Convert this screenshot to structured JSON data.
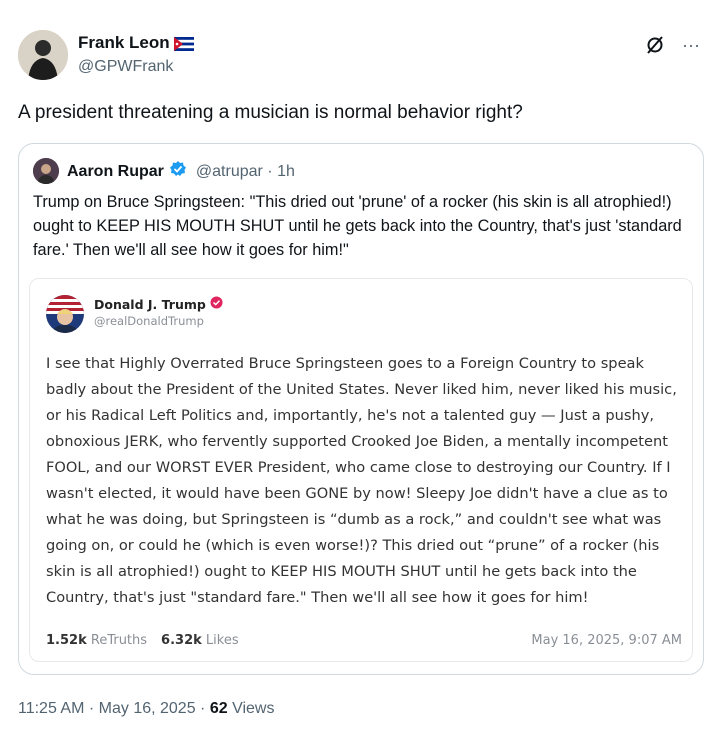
{
  "post": {
    "author_name": "Frank Leon",
    "author_handle": "@GPWFrank",
    "text": "A president threatening a musician is normal behavior right?",
    "time": "11:25 AM",
    "date": "May 16, 2025",
    "views_count": "62",
    "views_label": "Views",
    "more_glyph": "···"
  },
  "quote": {
    "author_name": "Aaron Rupar",
    "author_handle": "@atrupar",
    "age": "1h",
    "text": "Trump on Bruce Springsteen: \"This dried out 'prune' of a rocker (his skin is all atrophied!) ought to KEEP HIS MOUTH SHUT until he gets back into the Country, that's just 'standard fare.' Then we'll all see how it goes for him!\""
  },
  "truth": {
    "author_name": "Donald J. Trump",
    "author_handle": "@realDonaldTrump",
    "text": "I see that Highly Overrated Bruce Springsteen goes to a Foreign Country to speak badly about the President of the United States. Never liked him, never liked his music, or his Radical Left Politics and, importantly, he's not a talented guy — Just a pushy, obnoxious JERK, who fervently supported Crooked Joe Biden, a mentally incompetent FOOL, and our WORST EVER President, who came close to destroying our Country. If I wasn't elected, it would have been GONE by now! Sleepy Joe didn't have a clue as to what he was doing, but Springsteen is “dumb as a rock,” and couldn't see what was going on, or could he (which is even worse!)? This dried out “prune” of a rocker (his skin is all atrophied!) ought to KEEP HIS MOUTH SHUT until he gets back into the Country, that's just \"standard fare.\" Then we'll all see how it goes for him!",
    "retruths_count": "1.52k",
    "retruths_label": "ReTruths",
    "likes_count": "6.32k",
    "likes_label": "Likes",
    "date": "May 16, 2025, 9:07 AM"
  },
  "colors": {
    "verified_blue": "#1d9bf0",
    "truth_badge": "#e0245e",
    "secondary_text": "#536471"
  },
  "icons": [
    "user-avatar",
    "cuba-flag-icon",
    "grok-icon",
    "more-icon",
    "verified-badge-icon",
    "truth-verified-icon"
  ]
}
